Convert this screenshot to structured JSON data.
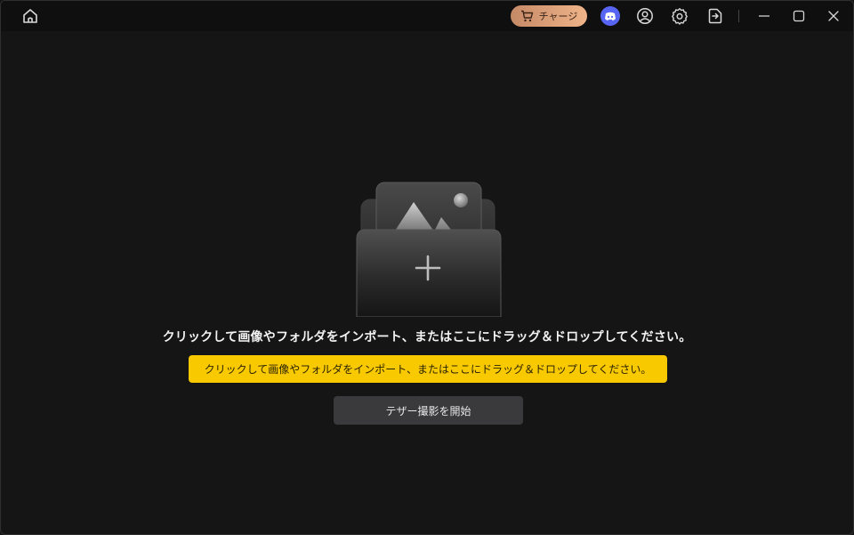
{
  "titlebar": {
    "charge_label": "チャージ",
    "icons": {
      "home": "home-icon",
      "cart": "cart-icon",
      "discord": "discord-icon",
      "user": "user-icon",
      "settings": "gear-icon",
      "exit": "exit-icon",
      "minimize": "minimize-icon",
      "maximize": "maximize-icon",
      "close": "close-icon"
    },
    "colors": {
      "charge_gradient_start": "#c58a66",
      "charge_gradient_end": "#f0b48a",
      "discord": "#5865f2"
    }
  },
  "main": {
    "drop_text": "クリックして画像やフォルダをインポート、またはここにドラッグ＆ドロップしてください。",
    "tooltip_text": "クリックして画像やフォルダをインポート、またはここにドラッグ＆ドロップしてください。",
    "tether_button_label": "テザー撮影を開始",
    "illustration_icon": "folder-image-add-icon",
    "colors": {
      "tooltip_bg": "#f9c900",
      "background": "#151515"
    }
  }
}
